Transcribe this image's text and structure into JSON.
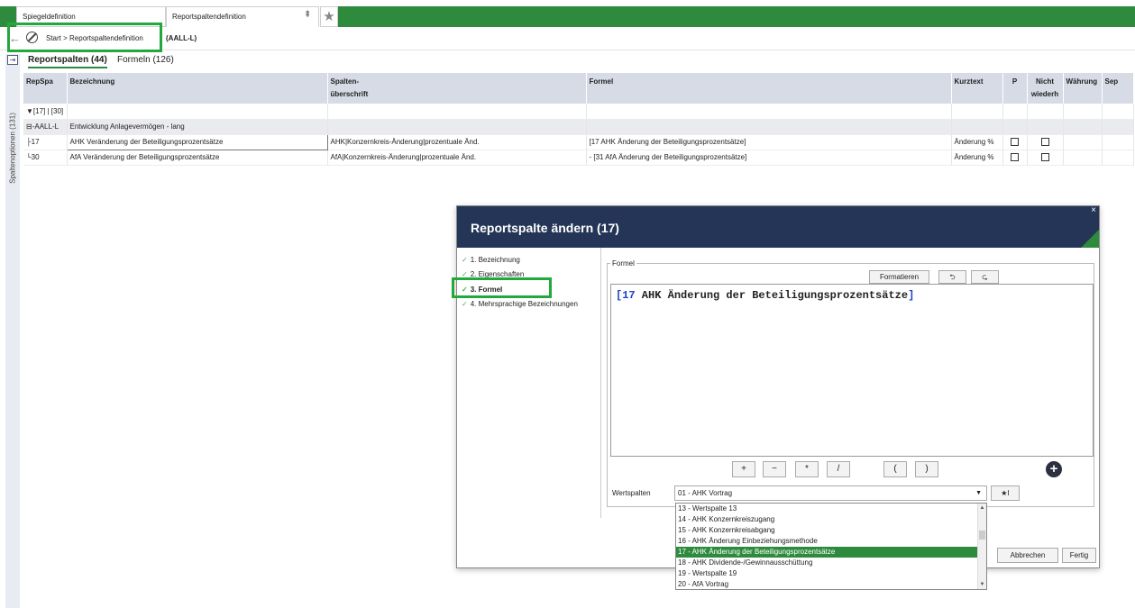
{
  "tabs": [
    {
      "label": "Spiegeldefinition"
    },
    {
      "label": "Reportspaltendefinition"
    }
  ],
  "breadcrumb": {
    "path": "Start > Reportspaltendefinition",
    "id": "(AALL-L)"
  },
  "side_rail": {
    "label": "Spaltenoptionen (131)"
  },
  "content_tabs": [
    {
      "label": "Reportspalten (44)"
    },
    {
      "label": "Formeln (126)"
    }
  ],
  "table": {
    "headers": {
      "repspa": "RepSpa",
      "bezeichnung": "Bezeichnung",
      "spalten1": "Spalten-",
      "spalten2": "überschrift",
      "formel": "Formel",
      "kurztext": "Kurztext",
      "p": "P",
      "nicht1": "Nicht",
      "nicht2": "wiederh",
      "waehrung": "Währung",
      "sep": "Sep"
    },
    "filter": "[17] | [30]",
    "group": {
      "id": "⊟-AALL-L",
      "bezeichnung": "Entwicklung Anlagevermögen - lang"
    },
    "rows": [
      {
        "repspa": "├17",
        "bezeichnung": "AHK Veränderung der Beteiligungsprozentsätze",
        "ueberschrift": "AHK|Konzernkreis-Änderung|prozentuale Änd.",
        "formel": "[17 AHK Änderung der Beteiligungsprozentsätze]",
        "kurztext": "Änderung %"
      },
      {
        "repspa": "└30",
        "bezeichnung": "AfA Veränderung der Beteiligungsprozentsätze",
        "ueberschrift": "AfA|Konzernkreis-Änderung|prozentuale Änd.",
        "formel": "- [31 AfA Änderung der Beteiligungsprozentsätze]",
        "kurztext": "Änderung %"
      }
    ]
  },
  "dialog": {
    "title": "Reportspalte ändern (17)",
    "steps": [
      {
        "label": "1. Bezeichnung"
      },
      {
        "label": "2. Eigenschaften"
      },
      {
        "label": "3. Formel"
      },
      {
        "label": "4. Mehrsprachige Bezeichnungen"
      }
    ],
    "formel_legend": "Formel",
    "format_button": "Formatieren",
    "formula_open": "[17",
    "formula_text": " AHK Änderung der Beteiligungsprozentsätze",
    "formula_close": "]",
    "operators": {
      "plus": "+",
      "minus": "−",
      "mul": "*",
      "div": "/",
      "lparen": "(",
      "rparen": ")"
    },
    "wertspalten_label": "Wertspalten",
    "wertspalten_value": "01 - AHK Vortrag",
    "insert_button": "★I",
    "cancel_button": "Abbrechen",
    "finish_button": "Fertig"
  },
  "dropdown": {
    "items": [
      "13 - Wertspalte 13",
      "14 - AHK Konzernkreiszugang",
      "15 - AHK Konzernkreisabgang",
      "16 - AHK Änderung Einbeziehungsmethode",
      "17 - AHK Änderung der Beteiligungsprozentsätze",
      "18 - AHK Dividende-/Gewinnausschüttung",
      "19 - Wertspalte 19",
      "20 - AfA Vortrag"
    ],
    "selected_index": 4
  },
  "colors": {
    "brand_green": "#2e8b3d",
    "header_navy": "#243557",
    "highlight": "#23a83e"
  }
}
